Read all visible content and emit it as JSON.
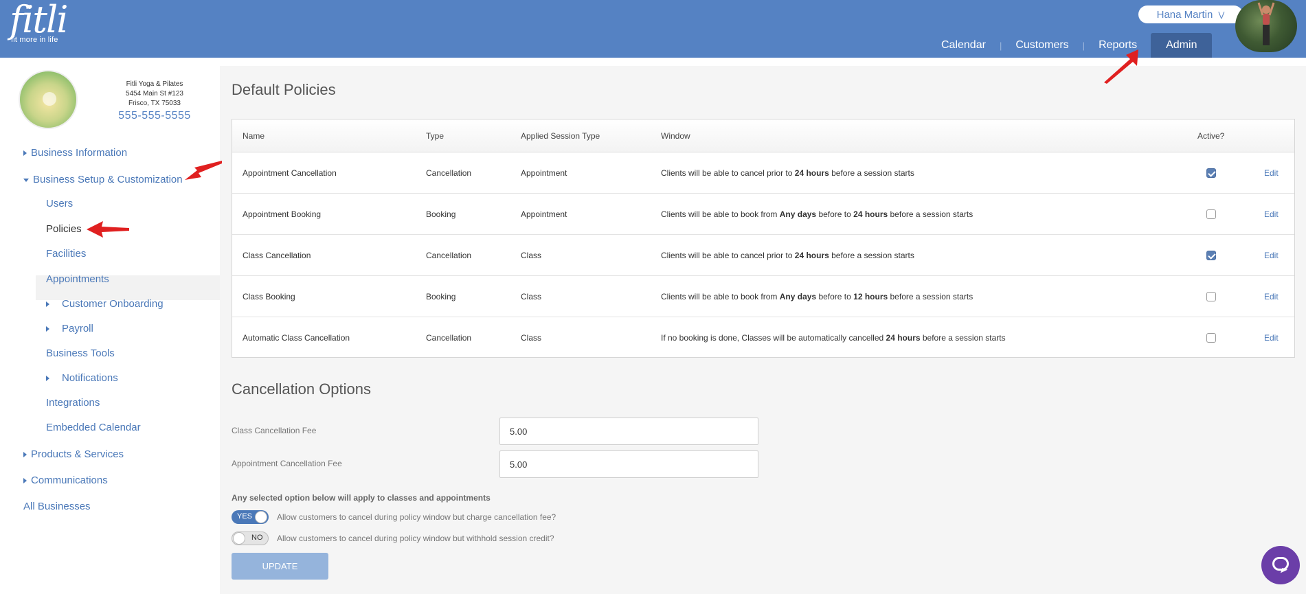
{
  "header": {
    "logo": "fitli",
    "tagline": "fit more in life",
    "user_name": "Hana Martin",
    "nav": [
      {
        "label": "Calendar",
        "active": false
      },
      {
        "label": "Customers",
        "active": false
      },
      {
        "label": "Reports",
        "active": false
      },
      {
        "label": "Admin",
        "active": true
      }
    ],
    "brand_color": "#5582c3"
  },
  "business": {
    "name": "Fitli Yoga & Pilates",
    "address1": "5454 Main St #123",
    "address2": "Frisco, TX 75033",
    "phone": "555-555-5555"
  },
  "sidebar": {
    "items": [
      {
        "label": "Business Information",
        "caret": "right",
        "level": 0
      },
      {
        "label": "Business Setup & Customization",
        "caret": "down",
        "level": 0
      },
      {
        "label": "Users",
        "level": 1
      },
      {
        "label": "Policies",
        "level": 1,
        "active": true
      },
      {
        "label": "Facilities",
        "level": 1
      },
      {
        "label": "Appointments",
        "level": 1
      },
      {
        "label": "Customer Onboarding",
        "caret": "right",
        "level": 1
      },
      {
        "label": "Payroll",
        "caret": "right",
        "level": 1
      },
      {
        "label": "Business Tools",
        "level": 1
      },
      {
        "label": "Notifications",
        "caret": "right",
        "level": 1
      },
      {
        "label": "Integrations",
        "level": 1
      },
      {
        "label": "Embedded Calendar",
        "level": 1
      },
      {
        "label": "Products & Services",
        "caret": "right",
        "level": 0
      },
      {
        "label": "Communications",
        "caret": "right",
        "level": 0
      },
      {
        "label": "All Businesses",
        "level": 0
      }
    ]
  },
  "policies": {
    "title": "Default Policies",
    "columns": [
      "Name",
      "Type",
      "Applied Session Type",
      "Window",
      "Active?"
    ],
    "edit_label": "Edit",
    "rows": [
      {
        "name": "Appointment Cancellation",
        "type": "Cancellation",
        "session": "Appointment",
        "w1": "Clients will be able to cancel prior to ",
        "b1": "24 hours",
        "w2": " before a session starts",
        "b2": "",
        "w3": "",
        "active": true
      },
      {
        "name": "Appointment Booking",
        "type": "Booking",
        "session": "Appointment",
        "w1": "Clients will be able to book from ",
        "b1": "Any days",
        "w2": " before to ",
        "b2": "24 hours",
        "w3": " before a session starts",
        "active": false
      },
      {
        "name": "Class Cancellation",
        "type": "Cancellation",
        "session": "Class",
        "w1": "Clients will be able to cancel prior to ",
        "b1": "24 hours",
        "w2": " before a session starts",
        "b2": "",
        "w3": "",
        "active": true
      },
      {
        "name": "Class Booking",
        "type": "Booking",
        "session": "Class",
        "w1": "Clients will be able to book from ",
        "b1": "Any days",
        "w2": " before to ",
        "b2": "12 hours",
        "w3": " before a session starts",
        "active": false
      },
      {
        "name": "Automatic Class Cancellation",
        "type": "Cancellation",
        "session": "Class",
        "w1": "If no booking is done, Classes will be automatically cancelled ",
        "b1": "24 hours",
        "w2": " before a session starts",
        "b2": "",
        "w3": "",
        "active": false
      }
    ]
  },
  "cancellation": {
    "title": "Cancellation Options",
    "class_fee_label": "Class Cancellation Fee",
    "class_fee_value": "5.00",
    "appt_fee_label": "Appointment Cancellation Fee",
    "appt_fee_value": "5.00",
    "note": "Any selected option below will apply to classes and appointments",
    "toggle1": {
      "state": "YES",
      "label": "Allow customers to cancel during policy window but charge cancellation fee?"
    },
    "toggle2": {
      "state": "NO",
      "label": "Allow customers to cancel during policy window but withhold session credit?"
    },
    "update_label": "UPDATE"
  }
}
